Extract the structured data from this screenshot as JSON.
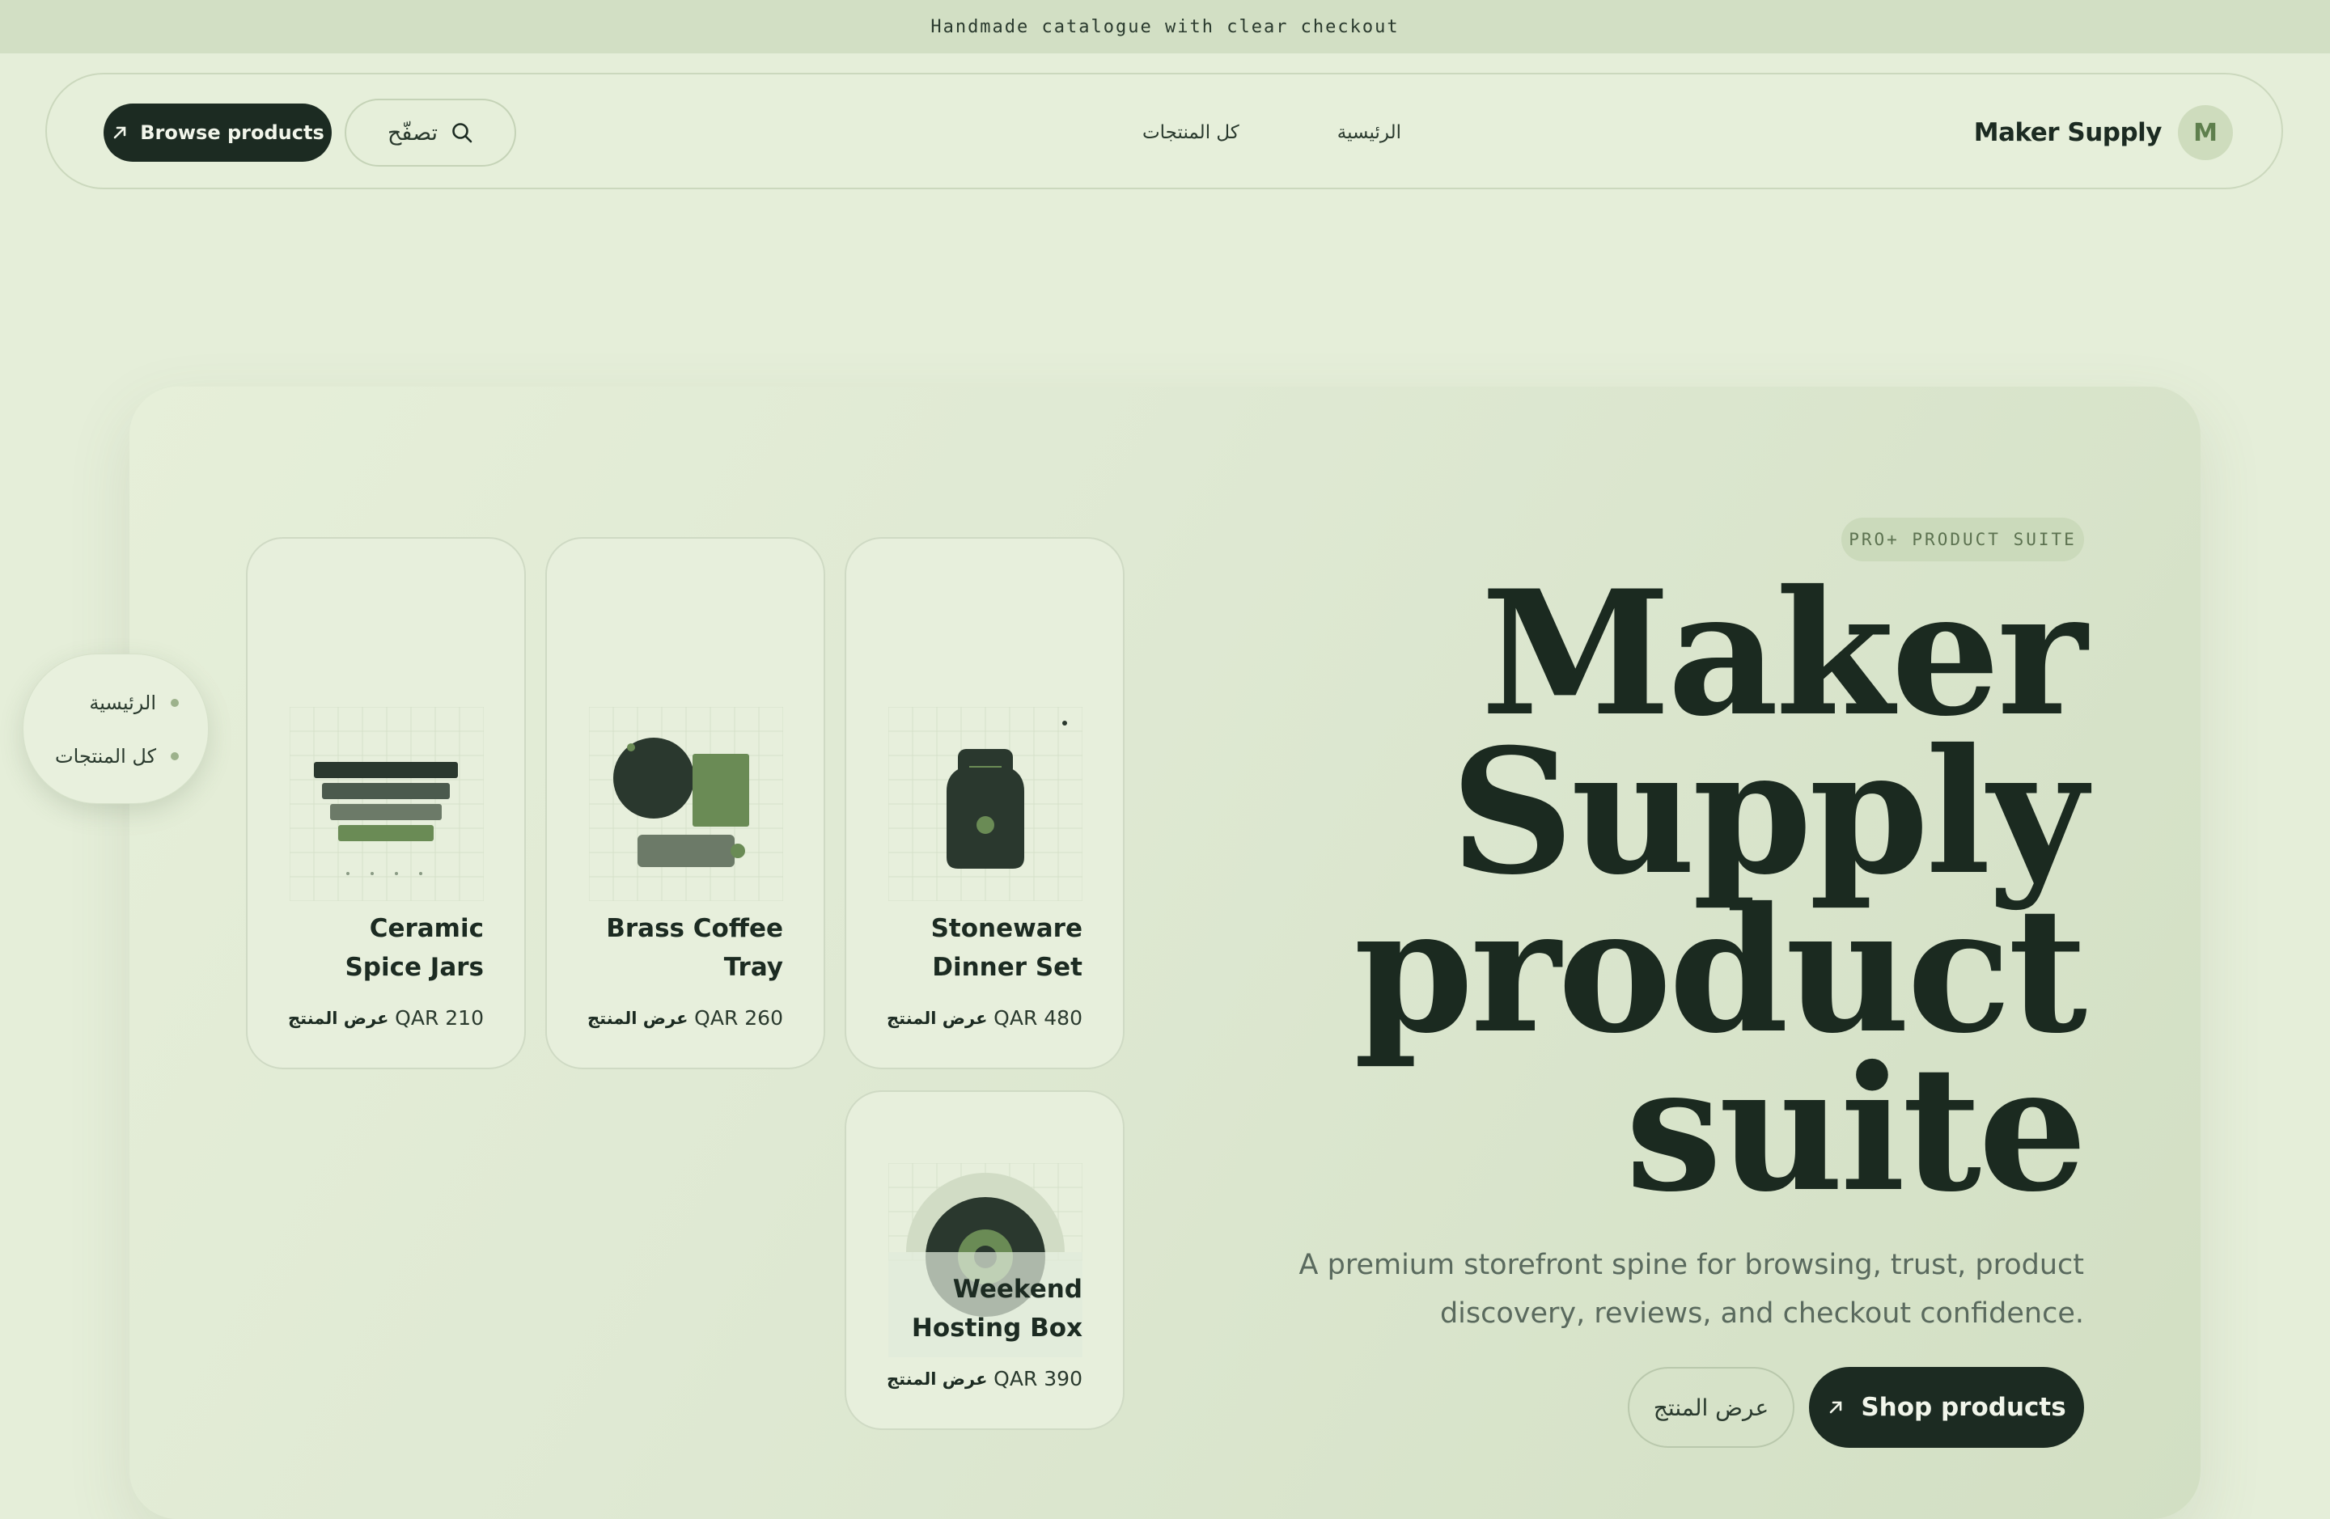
{
  "announcement": "Handmade catalogue with clear checkout",
  "nav": {
    "browse_label": "Browse products",
    "search_label": "تصفّح",
    "links": [
      "الرئيسية",
      "كل المنتجات"
    ],
    "brand": "Maker Supply",
    "brand_initial": "M"
  },
  "side_nav": [
    "الرئيسية",
    "كل المنتجات"
  ],
  "hero": {
    "badge": "PRO+ PRODUCT SUITE",
    "headline": [
      "Maker",
      "Supply",
      "product",
      "suite"
    ],
    "subcopy": "A premium storefront spine for browsing, trust, product discovery, reviews, and checkout confidence.",
    "secondary_cta": "عرض المنتج",
    "primary_cta": "Shop products"
  },
  "products": [
    {
      "title": "Ceramic Spice Jars",
      "price": "QAR 210",
      "action": "عرض المنتج"
    },
    {
      "title": "Brass Coffee Tray",
      "price": "QAR 260",
      "action": "عرض المنتج"
    },
    {
      "title": "Stoneware Dinner Set",
      "price": "QAR 480",
      "action": "عرض المنتج"
    },
    {
      "title": "Weekend Hosting Box",
      "price": "QAR 390",
      "action": "عرض المنتج"
    }
  ],
  "colors": {
    "background": "#e5eed9",
    "ink": "#1c2b22",
    "accent": "#5e7f4d"
  }
}
